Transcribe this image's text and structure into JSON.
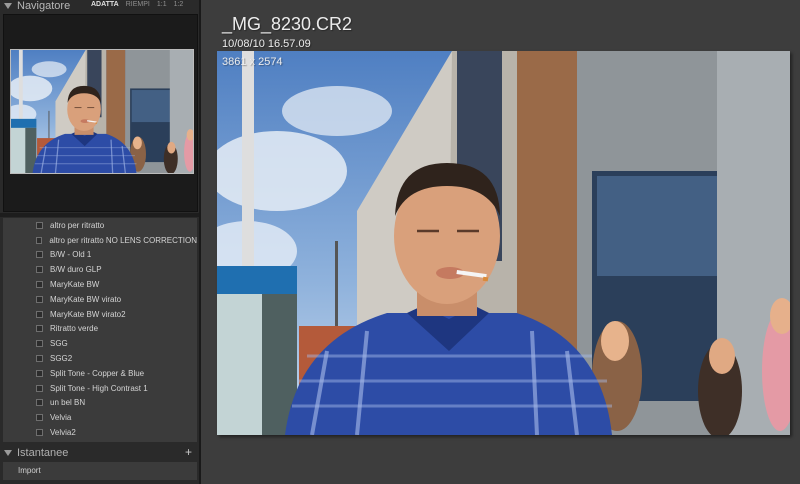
{
  "navigator": {
    "title": "Navigatore",
    "options": [
      "ADATTA",
      "RIEMPI",
      "1:1",
      "1:2"
    ],
    "active_option": "ADATTA"
  },
  "presets": [
    "altro per ritratto",
    "altro per ritratto NO LENS CORRECTION",
    "B/W - Old 1",
    "B/W duro GLP",
    "MaryKate BW",
    "MaryKate BW virato",
    "MaryKate BW virato2",
    "Ritratto verde",
    "SGG",
    "SGG2",
    "Split Tone - Copper & Blue",
    "Split Tone - High Contrast 1",
    "un bel BN",
    "Velvia",
    "Velvia2"
  ],
  "snapshots": {
    "title": "Istantanee",
    "add_symbol": "+"
  },
  "import_label": "Import",
  "photo_info": {
    "filename": "_MG_8230.CR2",
    "datetime": "10/08/10 16.57.09",
    "dimensions": "3861 x 2574"
  }
}
